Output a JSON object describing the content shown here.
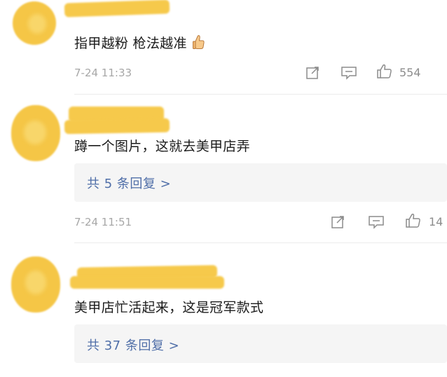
{
  "comments": [
    {
      "text": "指甲越粉 枪法越准",
      "emoji": "thumbs-up-emoji",
      "timestamp": "7-24 11:33",
      "likes": "554",
      "icons": [
        "share-icon",
        "comment-icon",
        "like-icon"
      ]
    },
    {
      "text": "蹲一个图片，这就去美甲店弄",
      "reply_summary": "共 5 条回复 >",
      "timestamp": "7-24 11:51",
      "likes": "14",
      "icons": [
        "share-icon",
        "comment-icon",
        "like-icon"
      ]
    },
    {
      "text": "美甲店忙活起来，这是冠军款式",
      "reply_summary": "共 37 条回复 >"
    }
  ],
  "colors": {
    "redaction": "#f5c646",
    "link": "#4f6ea8",
    "meta": "#a7a7a7",
    "reply_bg": "#f5f5f5"
  }
}
